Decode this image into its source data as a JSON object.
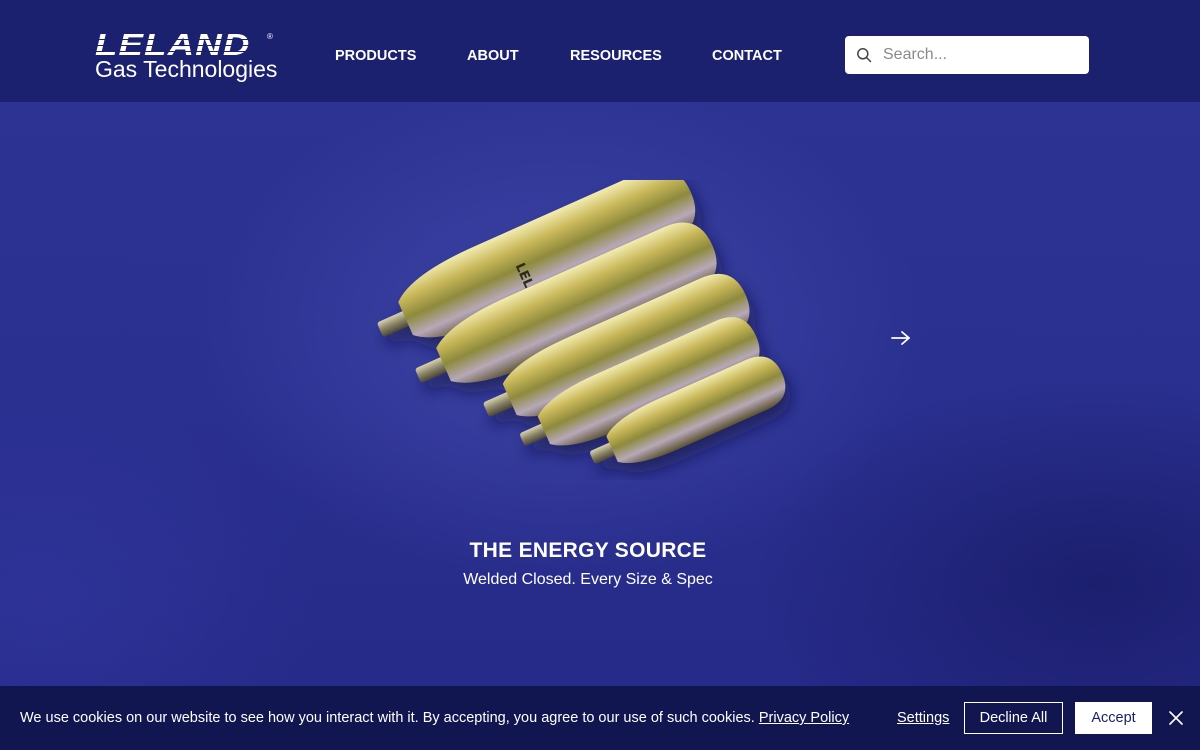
{
  "header": {
    "logo": {
      "main": "LELAND",
      "registered": "®",
      "sub": "Gas Technologies"
    },
    "nav": [
      {
        "label": "PRODUCTS"
      },
      {
        "label": "ABOUT"
      },
      {
        "label": "RESOURCES"
      },
      {
        "label": "CONTACT"
      }
    ],
    "search": {
      "placeholder": "Search...",
      "value": "",
      "icon": "search-icon"
    }
  },
  "hero": {
    "title": "THE ENERGY SOURCE",
    "subtitle": "Welded Closed. Every Size & Spec",
    "image": "gas-cartridges-product-image",
    "next_icon": "arrow-right-icon"
  },
  "cookie_banner": {
    "text": "We use cookies on our website to see how you interact with it. By accepting, you agree to our use of such cookies.",
    "policy_link": "Privacy Policy",
    "settings_label": "Settings",
    "decline_label": "Decline All",
    "accept_label": "Accept",
    "close_icon": "close-icon"
  },
  "colors": {
    "header_bg": "#1b206f",
    "hero_bg": "#2a3090",
    "cookie_bg": "#121650",
    "text": "#ffffff"
  }
}
